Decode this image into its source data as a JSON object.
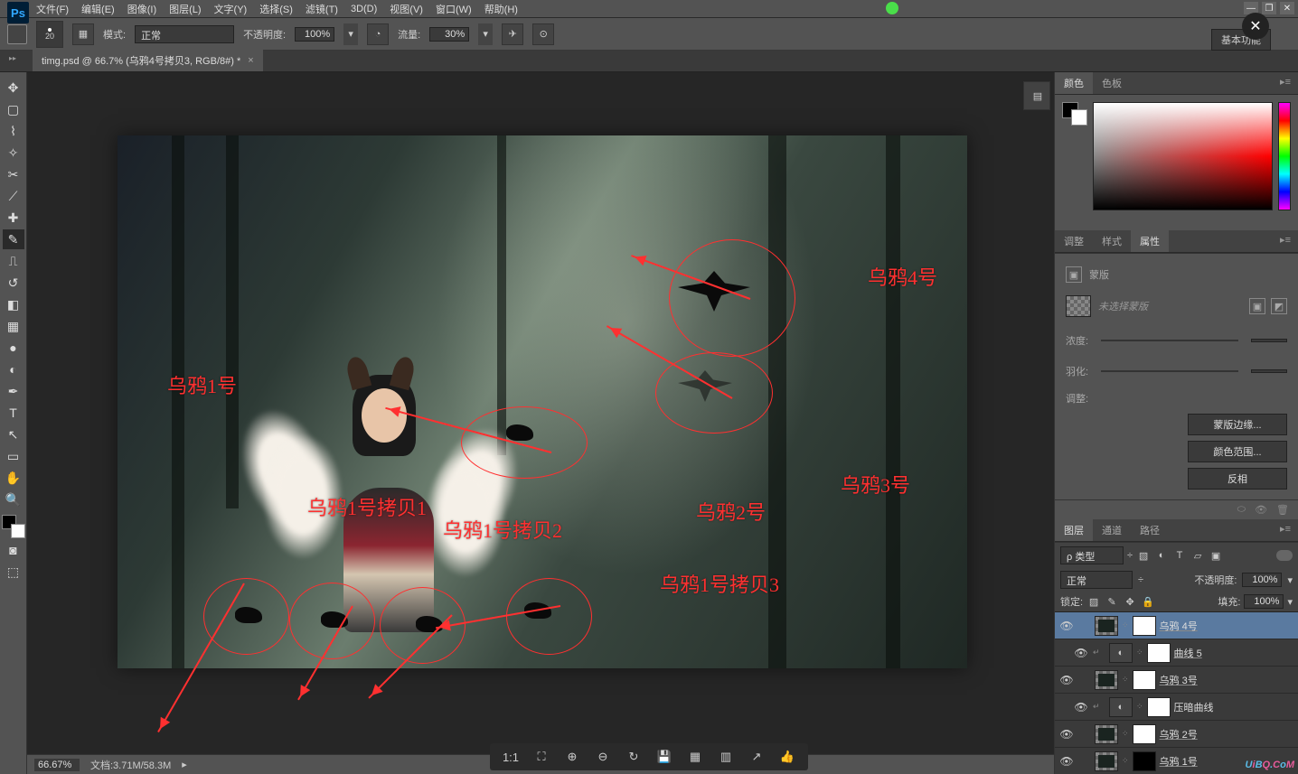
{
  "menu": {
    "file": "文件(F)",
    "edit": "编辑(E)",
    "image": "图像(I)",
    "layer": "图层(L)",
    "type": "文字(Y)",
    "select": "选择(S)",
    "filter": "滤镜(T)",
    "d3": "3D(D)",
    "view": "视图(V)",
    "window": "窗口(W)",
    "help": "帮助(H)"
  },
  "optbar": {
    "brush_size": "20",
    "mode_label": "模式:",
    "mode_val": "正常",
    "opacity_label": "不透明度:",
    "opacity_val": "100%",
    "flow_label": "流量:",
    "flow_val": "30%",
    "workspace": "基本功能"
  },
  "doc": {
    "tab": "timg.psd @ 66.7% (乌鸦4号拷贝3, RGB/8#) *"
  },
  "annotations": {
    "a1": "乌鸦1号",
    "a1c1": "乌鸦1号拷贝1",
    "a1c2": "乌鸦1号拷贝2",
    "a1c3": "乌鸦1号拷贝3",
    "a2": "乌鸦2号",
    "a3": "乌鸦3号",
    "a4": "乌鸦4号"
  },
  "color_tabs": {
    "color": "颜色",
    "swatch": "色板"
  },
  "prop_tabs": {
    "adjust": "调整",
    "style": "样式",
    "props": "属性"
  },
  "props": {
    "mask_title": "蒙版",
    "no_mask": "未选择蒙版",
    "density": "浓度:",
    "feather": "羽化:",
    "adjust_label": "调整:",
    "btn_edge": "蒙版边缘...",
    "btn_color": "颜色范围...",
    "btn_invert": "反相"
  },
  "layer_tabs": {
    "layers": "图层",
    "channels": "通道",
    "paths": "路径"
  },
  "layer_opts": {
    "kind": "ρ 类型",
    "blend": "正常",
    "opacity_label": "不透明度:",
    "opacity": "100%",
    "lock_label": "锁定:",
    "fill_label": "填充:",
    "fill": "100%"
  },
  "layers": [
    {
      "name": "乌鸦 4号",
      "sel": true,
      "mask": true
    },
    {
      "name": "曲线 5",
      "adj": true,
      "indent": true
    },
    {
      "name": "乌鸦 3号",
      "mask": true
    },
    {
      "name": "压暗曲线",
      "adj": true,
      "indent": true,
      "nou": true
    },
    {
      "name": "乌鸦 2号",
      "mask": true
    },
    {
      "name": "乌鸦 1号",
      "mask": true,
      "maskblk": true
    }
  ],
  "status": {
    "zoom": "66.67%",
    "doc": "文档:3.71M/58.3M"
  },
  "viewbar": {
    "ratio": "1:1"
  },
  "watermark": "UiBQ.CoM"
}
